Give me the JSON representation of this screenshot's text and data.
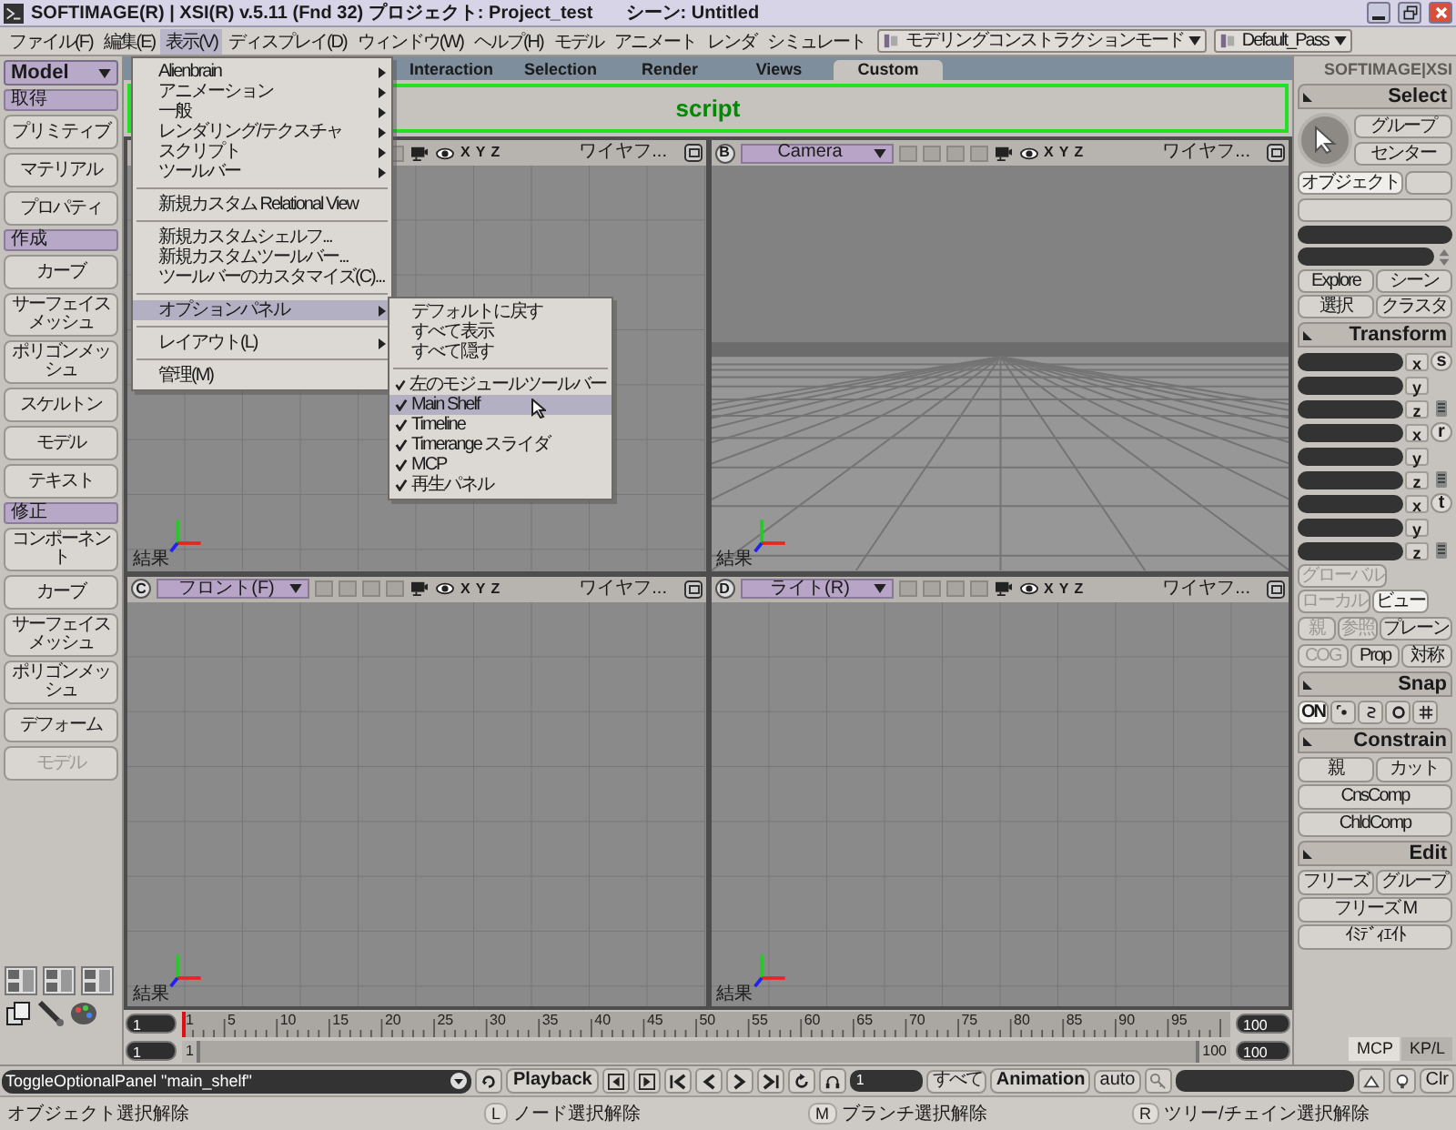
{
  "window": {
    "title": "SOFTIMAGE(R) | XSI(R) v.5.11 (Fnd 32) プロジェクト: Project_test",
    "scene": "シーン: Untitled"
  },
  "menubar": {
    "items": [
      {
        "label": "ファイル(F)",
        "open": false
      },
      {
        "label": "編集(E)",
        "open": false
      },
      {
        "label": "表示(V)",
        "open": true
      },
      {
        "label": "ディスプレイ(D)",
        "open": false
      },
      {
        "label": "ウィンドウ(W)",
        "open": false
      },
      {
        "label": "ヘルプ(H)",
        "open": false
      },
      {
        "label": "モデル",
        "open": false
      },
      {
        "label": "アニメート",
        "open": false
      },
      {
        "label": "レンダ",
        "open": false
      },
      {
        "label": "シミュレート",
        "open": false
      }
    ],
    "mode": "モデリングコンストラクションモード",
    "pass": "Default_Pass"
  },
  "left_panel": {
    "module": "Model",
    "items": [
      {
        "kind": "header",
        "label": "取得"
      },
      {
        "kind": "button",
        "label": "プリミティブ",
        "disabled": false
      },
      {
        "kind": "button",
        "label": "マテリアル",
        "disabled": false
      },
      {
        "kind": "button",
        "label": "プロパティ",
        "disabled": false
      },
      {
        "kind": "header",
        "label": "作成"
      },
      {
        "kind": "button",
        "label": "カーブ",
        "disabled": false
      },
      {
        "kind": "button",
        "label": "サーフェイスメッシュ",
        "disabled": false
      },
      {
        "kind": "button",
        "label": "ポリゴンメッシュ",
        "disabled": false
      },
      {
        "kind": "button",
        "label": "スケルトン",
        "disabled": false
      },
      {
        "kind": "button",
        "label": "モデル",
        "disabled": false
      },
      {
        "kind": "button",
        "label": "テキスト",
        "disabled": false
      },
      {
        "kind": "header",
        "label": "修正"
      },
      {
        "kind": "button",
        "label": "コンポーネント",
        "disabled": false
      },
      {
        "kind": "button",
        "label": "カーブ",
        "disabled": false
      },
      {
        "kind": "button",
        "label": "サーフェイスメッシュ",
        "disabled": false
      },
      {
        "kind": "button",
        "label": "ポリゴンメッシュ",
        "disabled": false
      },
      {
        "kind": "button",
        "label": "デフォーム",
        "disabled": false
      },
      {
        "kind": "button",
        "label": "モデル",
        "disabled": true
      }
    ]
  },
  "shelf": {
    "tabs": [
      {
        "label": "Interaction",
        "selected": false
      },
      {
        "label": "Selection",
        "selected": false
      },
      {
        "label": "Render",
        "selected": false
      },
      {
        "label": "Views",
        "selected": false
      },
      {
        "label": "Custom",
        "selected": true
      }
    ],
    "label": "script"
  },
  "viewports": [
    {
      "kind": "ortho",
      "axes": [
        "X",
        "Y",
        "Z"
      ],
      "shading": "ワイヤフ...",
      "footer": "結果"
    },
    {
      "kind": "perspective",
      "letter": "B",
      "view": "Camera",
      "axes": [
        "X",
        "Y",
        "Z"
      ],
      "shading": "ワイヤフ...",
      "footer": "結果"
    },
    {
      "kind": "ortho",
      "letter": "C",
      "view": "フロント(F)",
      "axes": [
        "X",
        "Y",
        "Z"
      ],
      "shading": "ワイヤフ...",
      "footer": "結果"
    },
    {
      "kind": "ortho",
      "letter": "D",
      "view": "ライト(R)",
      "axes": [
        "X",
        "Y",
        "Z"
      ],
      "shading": "ワイヤフ...",
      "footer": "結果"
    }
  ],
  "view_menu": {
    "items": [
      {
        "kind": "item",
        "label": "Alienbrain",
        "submenu": true,
        "selected": false
      },
      {
        "kind": "item",
        "label": "アニメーション",
        "submenu": true,
        "selected": false
      },
      {
        "kind": "item",
        "label": "一般",
        "submenu": true,
        "selected": false
      },
      {
        "kind": "item",
        "label": "レンダリング/テクスチャ",
        "submenu": true,
        "selected": false
      },
      {
        "kind": "item",
        "label": "スクリプト",
        "submenu": true,
        "selected": false
      },
      {
        "kind": "item",
        "label": "ツールバー",
        "submenu": true,
        "selected": false
      },
      {
        "kind": "separator"
      },
      {
        "kind": "item",
        "label": "新規カスタム Relational View",
        "submenu": false,
        "selected": false
      },
      {
        "kind": "separator"
      },
      {
        "kind": "item",
        "label": "新規カスタムシェルフ...",
        "submenu": false,
        "selected": false
      },
      {
        "kind": "item",
        "label": "新規カスタムツールバー...",
        "submenu": false,
        "selected": false
      },
      {
        "kind": "item",
        "label": "ツールバーのカスタマイズ(C)...",
        "submenu": false,
        "selected": false
      },
      {
        "kind": "separator"
      },
      {
        "kind": "item",
        "label": "オプションパネル",
        "submenu": true,
        "selected": true
      },
      {
        "kind": "separator"
      },
      {
        "kind": "item",
        "label": "レイアウト(L)",
        "submenu": true,
        "selected": false
      },
      {
        "kind": "separator"
      },
      {
        "kind": "item",
        "label": "管理(M)",
        "submenu": false,
        "selected": false
      }
    ]
  },
  "options_submenu": {
    "items": [
      {
        "kind": "item",
        "label": "デフォルトに戻す",
        "checked": false,
        "selected": false
      },
      {
        "kind": "item",
        "label": "すべて表示",
        "checked": false,
        "selected": false
      },
      {
        "kind": "item",
        "label": "すべて隠す",
        "checked": false,
        "selected": false
      },
      {
        "kind": "separator"
      },
      {
        "kind": "item",
        "label": "左のモジュールツールバー",
        "checked": true,
        "selected": false
      },
      {
        "kind": "item",
        "label": "Main Shelf",
        "checked": true,
        "selected": true
      },
      {
        "kind": "item",
        "label": "Timeline",
        "checked": true,
        "selected": false
      },
      {
        "kind": "item",
        "label": "Timerange スライダ",
        "checked": true,
        "selected": false
      },
      {
        "kind": "item",
        "label": "MCP",
        "checked": true,
        "selected": false
      },
      {
        "kind": "item",
        "label": "再生パネル",
        "checked": true,
        "selected": false
      }
    ]
  },
  "timeline": {
    "start_field": "1",
    "end_field": "100",
    "ticks": [
      "1",
      "5",
      "10",
      "15",
      "20",
      "25",
      "30",
      "35",
      "40",
      "45",
      "50",
      "55",
      "60",
      "65",
      "70",
      "75",
      "80",
      "85",
      "90",
      "95"
    ],
    "range_start_field": "1",
    "range_start": "1",
    "range_end": "100",
    "range_end_field": "100"
  },
  "right_panel": {
    "logo": "SOFTIMAGE|XSI",
    "select": {
      "title": "Select",
      "buttons": [
        {
          "label": "グループ",
          "selected": false
        },
        {
          "label": "センター",
          "selected": false
        },
        {
          "label": "オブジェクト",
          "selected": true
        }
      ],
      "scene_buttons": [
        {
          "label": "Explore"
        },
        {
          "label": "シーン"
        },
        {
          "label": "選択"
        },
        {
          "label": "クラスタ"
        }
      ]
    },
    "transform": {
      "title": "Transform",
      "groups": [
        {
          "mode": "s",
          "axes": [
            "x",
            "y",
            "z"
          ]
        },
        {
          "mode": "r",
          "axes": [
            "x",
            "y",
            "z"
          ]
        },
        {
          "mode": "t",
          "axes": [
            "x",
            "y",
            "z"
          ]
        }
      ],
      "reference": [
        {
          "label": "グローバル",
          "selected": false,
          "disabled": true
        },
        {
          "label": "ローカル",
          "selected": false,
          "disabled": true
        },
        {
          "label": "ビュー",
          "selected": true,
          "disabled": false
        }
      ],
      "modes": [
        {
          "label": "親",
          "disabled": true
        },
        {
          "label": "参照",
          "disabled": true
        },
        {
          "label": "プレーン",
          "disabled": false
        }
      ],
      "options": [
        {
          "label": "COG",
          "disabled": true
        },
        {
          "label": "Prop",
          "disabled": false
        },
        {
          "label": "対称",
          "disabled": false
        }
      ]
    },
    "snap": {
      "title": "Snap",
      "on": {
        "label": "ON",
        "selected": true
      }
    },
    "constrain": {
      "title": "Constrain",
      "buttons": [
        {
          "label": "親"
        },
        {
          "label": "カット"
        },
        {
          "label": "CnsComp"
        },
        {
          "label": "ChldComp"
        }
      ]
    },
    "edit": {
      "title": "Edit",
      "buttons": [
        {
          "label": "フリーズ"
        },
        {
          "label": "グループ"
        },
        {
          "label": "フリーズ M"
        },
        {
          "label": "ｲﾐﾃﾞｨｴｲﾄ"
        }
      ]
    },
    "tabs": [
      {
        "label": "MCP",
        "selected": true
      },
      {
        "label": "KP/L",
        "selected": false
      }
    ]
  },
  "command_bar": {
    "command": "ToggleOptionalPanel \"main_shelf\"",
    "playback": "Playback",
    "frame": "1",
    "all": "すべて",
    "animation": "Animation",
    "auto": "auto",
    "clear": "Clr"
  },
  "status_bar": [
    {
      "text": "オブジェクト選択解除"
    },
    {
      "key": "L",
      "text": "ノード選択解除"
    },
    {
      "key": "M",
      "text": "ブランチ選択解除"
    },
    {
      "key": "R",
      "text": "ツリー/チェイン選択解除"
    }
  ]
}
